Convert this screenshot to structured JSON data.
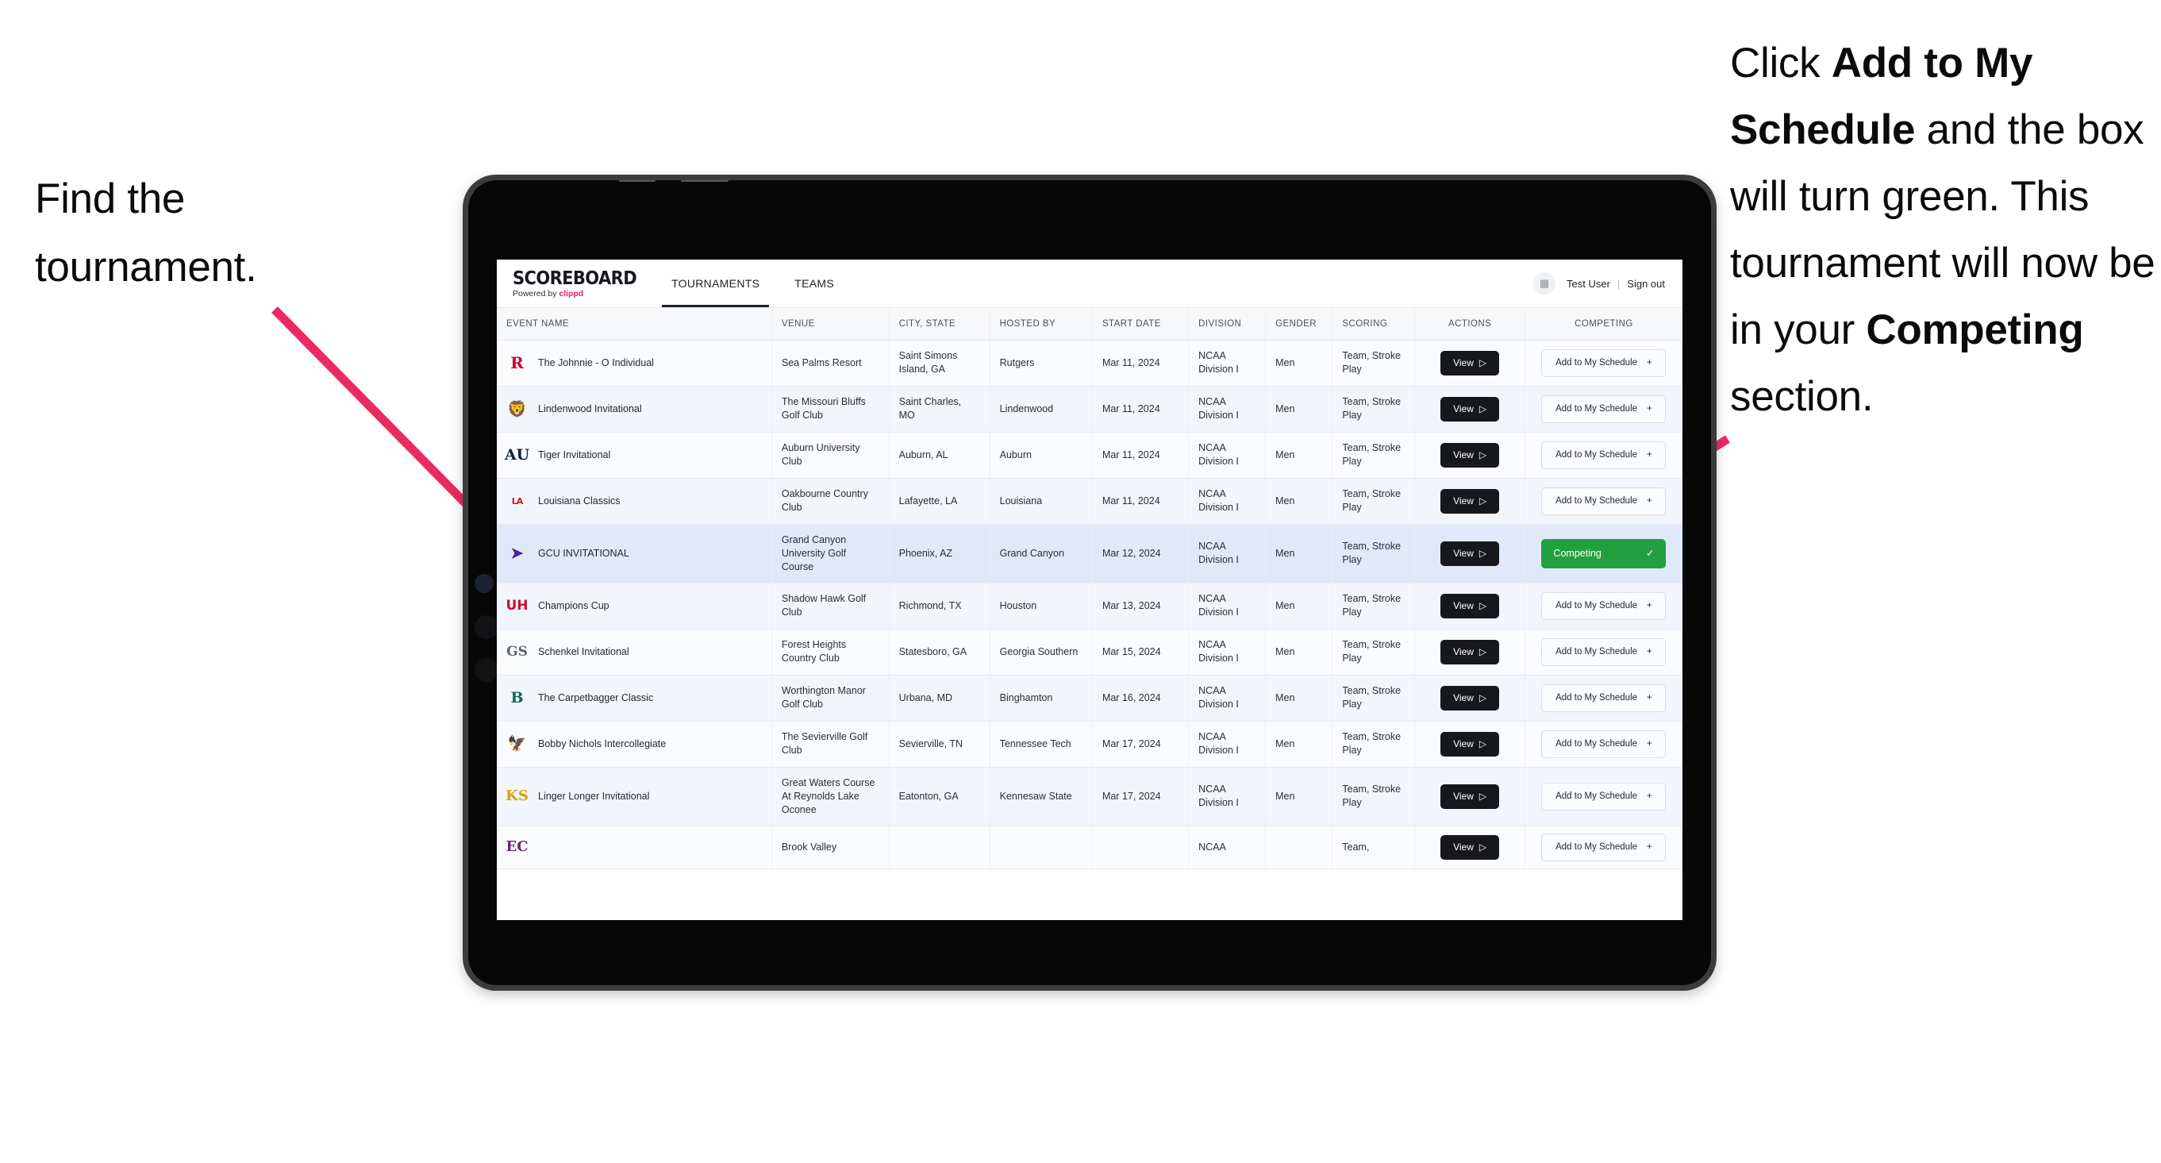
{
  "annotations": {
    "left": {
      "line1": "Find the",
      "line2": "tournament."
    },
    "right": {
      "seg1": "Click ",
      "bold1": "Add to My Schedule",
      "seg2": " and the box will turn green. This tournament will now be in your ",
      "bold2": "Competing",
      "seg3": " section."
    },
    "arrow_color": "#ec2a62"
  },
  "app": {
    "brand": {
      "title": "SCOREBOARD",
      "powered_prefix": "Powered by ",
      "powered_brand": "clippd",
      "brand_accent": "#ec1b5a"
    },
    "nav_tabs": [
      {
        "label": "TOURNAMENTS",
        "active": true
      },
      {
        "label": "TEAMS",
        "active": false
      }
    ],
    "user": {
      "avatar_icon": "user-grid-icon",
      "name": "Test User",
      "separator": "|",
      "sign_out": "Sign out"
    },
    "table": {
      "columns": [
        "EVENT NAME",
        "VENUE",
        "CITY, STATE",
        "HOSTED BY",
        "START DATE",
        "DIVISION",
        "GENDER",
        "SCORING",
        "ACTIONS",
        "COMPETING"
      ],
      "view_label": "View",
      "add_label": "Add to My Schedule",
      "add_plus": "+",
      "competing_label": "Competing",
      "competing_check": "✓",
      "competing_color": "#22a03f",
      "rows": [
        {
          "logo_glyph": "R",
          "logo_class": "lg-rutgers",
          "event": "The Johnnie - O Individual",
          "venue": "Sea Palms Resort",
          "city": "Saint Simons Island, GA",
          "host": "Rutgers",
          "date": "Mar 11, 2024",
          "division": "NCAA Division I",
          "gender": "Men",
          "scoring": "Team, Stroke Play",
          "competing": false
        },
        {
          "logo_glyph": "🦁",
          "logo_class": "lg-lindenwood",
          "event": "Lindenwood Invitational",
          "venue": "The Missouri Bluffs Golf Club",
          "city": "Saint Charles, MO",
          "host": "Lindenwood",
          "date": "Mar 11, 2024",
          "division": "NCAA Division I",
          "gender": "Men",
          "scoring": "Team, Stroke Play",
          "competing": false
        },
        {
          "logo_glyph": "AU",
          "logo_class": "lg-auburn",
          "event": "Tiger Invitational",
          "venue": "Auburn University Club",
          "city": "Auburn, AL",
          "host": "Auburn",
          "date": "Mar 11, 2024",
          "division": "NCAA Division I",
          "gender": "Men",
          "scoring": "Team, Stroke Play",
          "competing": false
        },
        {
          "logo_glyph": "LA",
          "logo_class": "lg-louisiana",
          "event": "Louisiana Classics",
          "venue": "Oakbourne Country Club",
          "city": "Lafayette, LA",
          "host": "Louisiana",
          "date": "Mar 11, 2024",
          "division": "NCAA Division I",
          "gender": "Men",
          "scoring": "Team, Stroke Play",
          "competing": false
        },
        {
          "logo_glyph": "➤",
          "logo_class": "lg-gcu",
          "event": "GCU INVITATIONAL",
          "venue": "Grand Canyon University Golf Course",
          "city": "Phoenix, AZ",
          "host": "Grand Canyon",
          "date": "Mar 12, 2024",
          "division": "NCAA Division I",
          "gender": "Men",
          "scoring": "Team, Stroke Play",
          "competing": true,
          "selected": true
        },
        {
          "logo_glyph": "UH",
          "logo_class": "lg-houston",
          "event": "Champions Cup",
          "venue": "Shadow Hawk Golf Club",
          "city": "Richmond, TX",
          "host": "Houston",
          "date": "Mar 13, 2024",
          "division": "NCAA Division I",
          "gender": "Men",
          "scoring": "Team, Stroke Play",
          "competing": false
        },
        {
          "logo_glyph": "GS",
          "logo_class": "lg-gasou",
          "event": "Schenkel Invitational",
          "venue": "Forest Heights Country Club",
          "city": "Statesboro, GA",
          "host": "Georgia Southern",
          "date": "Mar 15, 2024",
          "division": "NCAA Division I",
          "gender": "Men",
          "scoring": "Team, Stroke Play",
          "competing": false
        },
        {
          "logo_glyph": "B",
          "logo_class": "lg-bing",
          "event": "The Carpetbagger Classic",
          "venue": "Worthington Manor Golf Club",
          "city": "Urbana, MD",
          "host": "Binghamton",
          "date": "Mar 16, 2024",
          "division": "NCAA Division I",
          "gender": "Men",
          "scoring": "Team, Stroke Play",
          "competing": false
        },
        {
          "logo_glyph": "🦅",
          "logo_class": "lg-ttech",
          "event": "Bobby Nichols Intercollegiate",
          "venue": "The Sevierville Golf Club",
          "city": "Sevierville, TN",
          "host": "Tennessee Tech",
          "date": "Mar 17, 2024",
          "division": "NCAA Division I",
          "gender": "Men",
          "scoring": "Team, Stroke Play",
          "competing": false
        },
        {
          "logo_glyph": "KS",
          "logo_class": "lg-kennesaw",
          "event": "Linger Longer Invitational",
          "venue": "Great Waters Course At Reynolds Lake Oconee",
          "city": "Eatonton, GA",
          "host": "Kennesaw State",
          "date": "Mar 17, 2024",
          "division": "NCAA Division I",
          "gender": "Men",
          "scoring": "Team, Stroke Play",
          "competing": false
        },
        {
          "logo_glyph": "EC",
          "logo_class": "lg-ecu",
          "event": "",
          "venue": "Brook Valley",
          "city": "",
          "host": "",
          "date": "",
          "division": "NCAA",
          "gender": "",
          "scoring": "Team,",
          "competing": false,
          "cut": true
        }
      ]
    }
  }
}
